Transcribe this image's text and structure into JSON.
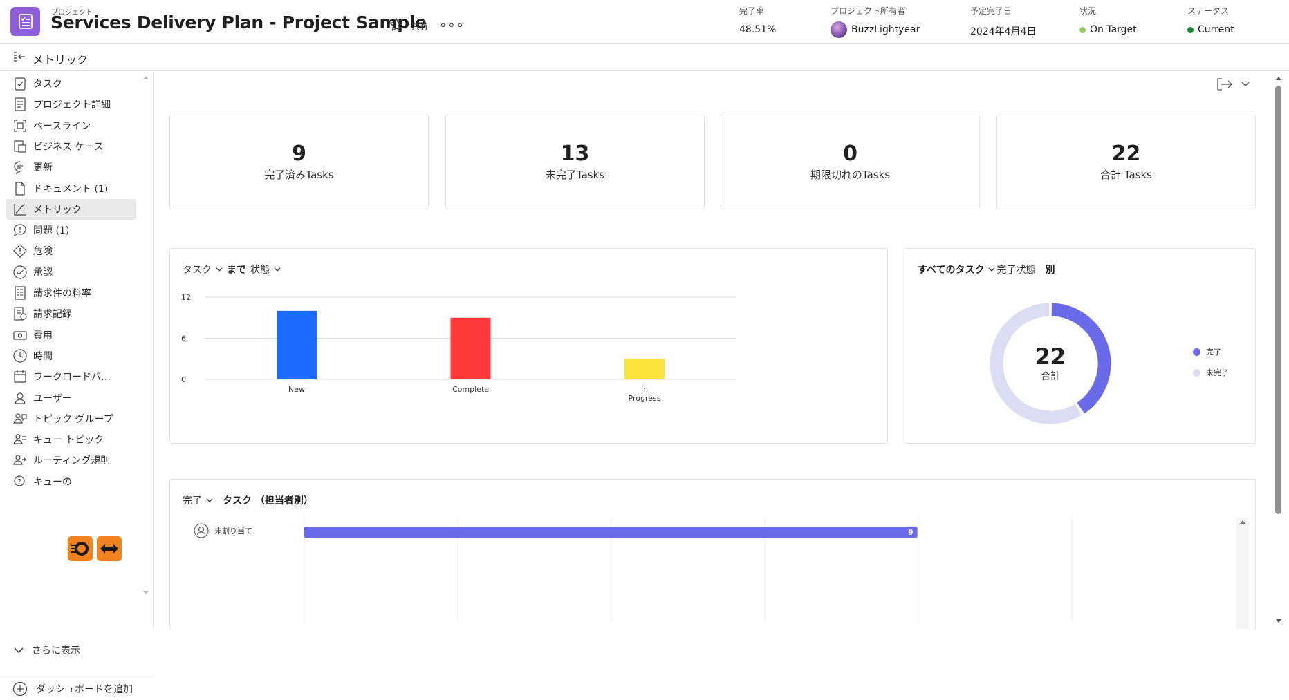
{
  "header": {
    "project_label": "プロジェクト",
    "project_title": "Services Delivery Plan - Project Sample",
    "share_label": "共有",
    "more_label": "∘∘∘",
    "meta": [
      {
        "label": "完了率",
        "value": "48.51%"
      },
      {
        "label": "プロジェクト所有者",
        "value": "BuzzLightyear"
      },
      {
        "label": "予定完了日",
        "value": "2024年4月4日"
      },
      {
        "label": "状況",
        "value": "On Target",
        "color": "#8fd14f"
      },
      {
        "label": "ステータス",
        "value": "Current",
        "color": "#128a2e"
      }
    ]
  },
  "subbar": {
    "title": "メトリック"
  },
  "sidebar": {
    "items": [
      {
        "label": "タスク",
        "icon": "task-icon"
      },
      {
        "label": "プロジェクト詳細",
        "icon": "document-details-icon"
      },
      {
        "label": "ベースライン",
        "icon": "baseline-icon"
      },
      {
        "label": "ビジネス ケース",
        "icon": "business-case-icon"
      },
      {
        "label": "更新",
        "icon": "comment-icon"
      },
      {
        "label": "ドキュメント (1)",
        "icon": "file-icon"
      },
      {
        "label": "メトリック",
        "icon": "line-chart-icon",
        "active": true
      },
      {
        "label": "問題 (1)",
        "icon": "issue-icon"
      },
      {
        "label": "危険",
        "icon": "risk-icon"
      },
      {
        "label": "承認",
        "icon": "approval-icon"
      },
      {
        "label": "請求件の料率",
        "icon": "billing-rate-icon"
      },
      {
        "label": "請求記録",
        "icon": "billing-record-icon"
      },
      {
        "label": "費用",
        "icon": "expense-icon"
      },
      {
        "label": "時間",
        "icon": "clock-icon"
      },
      {
        "label": "ワークロードバ…",
        "icon": "calendar-icon"
      },
      {
        "label": "ユーザー",
        "icon": "user-icon"
      },
      {
        "label": "トピック グループ",
        "icon": "topic-group-icon"
      },
      {
        "label": "キュー トピック",
        "icon": "queue-topic-icon"
      },
      {
        "label": "ルーティング規則",
        "icon": "routing-rule-icon"
      },
      {
        "label": "キューの",
        "icon": "queue-settings-icon"
      }
    ],
    "show_more": "さらに表示",
    "add_dashboard": "ダッシュボードを追加"
  },
  "kpis": [
    {
      "value": "9",
      "label": "完了済みTasks"
    },
    {
      "value": "13",
      "label": "未完了Tasks"
    },
    {
      "value": "0",
      "label": "期限切れのTasks"
    },
    {
      "value": "22",
      "label": "合計 Tasks"
    }
  ],
  "bar_card": {
    "entity": "タスク",
    "by": "まで",
    "field": "状態"
  },
  "donut_card": {
    "entity": "すべてのタスク",
    "field": "完了状態",
    "suffix": "別",
    "center_value": "22",
    "center_label": "合計"
  },
  "assignee_card": {
    "filter": "完了",
    "title": "タスク （担当者別）",
    "rows": [
      {
        "name": "未割り当て",
        "value": 9
      }
    ]
  },
  "colors": {
    "accent": "#6b6bea",
    "new": "#1b6bff",
    "complete": "#ff3a3a",
    "in_progress": "#fde43a",
    "incomplete": "#dcdcf2"
  },
  "chart_data": [
    {
      "type": "bar",
      "categories": [
        "New",
        "Complete",
        "In Progress"
      ],
      "values": [
        10,
        9,
        3
      ],
      "colors": [
        "#1b6bff",
        "#ff3a3a",
        "#fde43a"
      ],
      "ylim": [
        0,
        12
      ],
      "yticks": [
        "0",
        "6",
        "12"
      ],
      "grid": true
    },
    {
      "type": "pie",
      "donut": true,
      "slices": [
        {
          "label": "完了",
          "value": 9,
          "color": "#6b6bea"
        },
        {
          "label": "未完了",
          "value": 13,
          "color": "#dcdcf2"
        }
      ],
      "legend": "right"
    },
    {
      "type": "bar",
      "orientation": "horizontal",
      "categories": [
        "未割り当て"
      ],
      "values": [
        9
      ],
      "xlim": [
        0,
        13.5
      ],
      "grid": true
    }
  ]
}
